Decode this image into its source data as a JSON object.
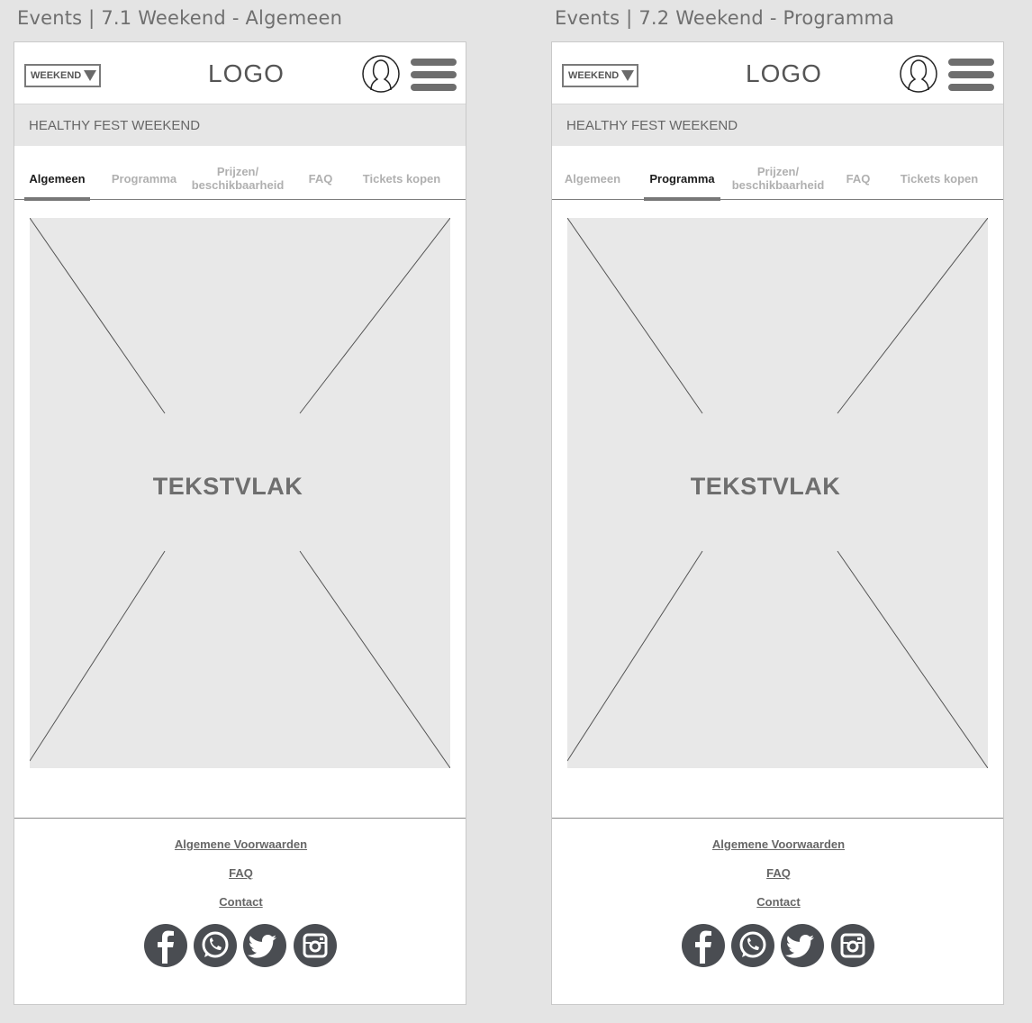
{
  "artboards": [
    {
      "title": "Events | 7.1 Weekend - Algemeen",
      "active_tab": "Algemeen",
      "header": {
        "select_label": "WEEKEND",
        "logo": "LOGO",
        "profile_icon": "user-avatar-icon",
        "menu_icon": "hamburger-menu-icon"
      },
      "subheader": "HEALTHY FEST WEEKEND",
      "tabs": [
        {
          "label": "Algemeen",
          "active": true
        },
        {
          "label": "Programma",
          "active": false
        },
        {
          "label": "Prijzen/ beschikbaarheid",
          "active": false
        },
        {
          "label": "FAQ",
          "active": false
        },
        {
          "label": "Tickets kopen",
          "active": false
        }
      ],
      "placeholder_label": "TEKSTVLAK",
      "footer": {
        "links": [
          "Algemene Voorwaarden",
          "FAQ",
          "Contact"
        ],
        "social_icons": [
          "facebook-icon",
          "whatsapp-icon",
          "twitter-icon",
          "instagram-icon"
        ]
      }
    },
    {
      "title": "Events | 7.2 Weekend - Programma",
      "active_tab": "Programma",
      "header": {
        "select_label": "WEEKEND",
        "logo": "LOGO",
        "profile_icon": "user-avatar-icon",
        "menu_icon": "hamburger-menu-icon"
      },
      "subheader": "HEALTHY FEST WEEKEND",
      "tabs": [
        {
          "label": "Algemeen",
          "active": false
        },
        {
          "label": "Programma",
          "active": true
        },
        {
          "label": "Prijzen/ beschikbaarheid",
          "active": false
        },
        {
          "label": "FAQ",
          "active": false
        },
        {
          "label": "Tickets kopen",
          "active": false
        }
      ],
      "placeholder_label": "TEKSTVLAK",
      "footer": {
        "links": [
          "Algemene Voorwaarden",
          "FAQ",
          "Contact"
        ],
        "social_icons": [
          "facebook-icon",
          "whatsapp-icon",
          "twitter-icon",
          "instagram-icon"
        ]
      }
    }
  ],
  "colors": {
    "canvas": "#e4e4e4",
    "panel": "#ffffff",
    "placeholder": "#e8e8e8",
    "text_muted": "#b0b0b0",
    "text_active": "#1c1c1c",
    "social_bg": "#4a4d52"
  }
}
